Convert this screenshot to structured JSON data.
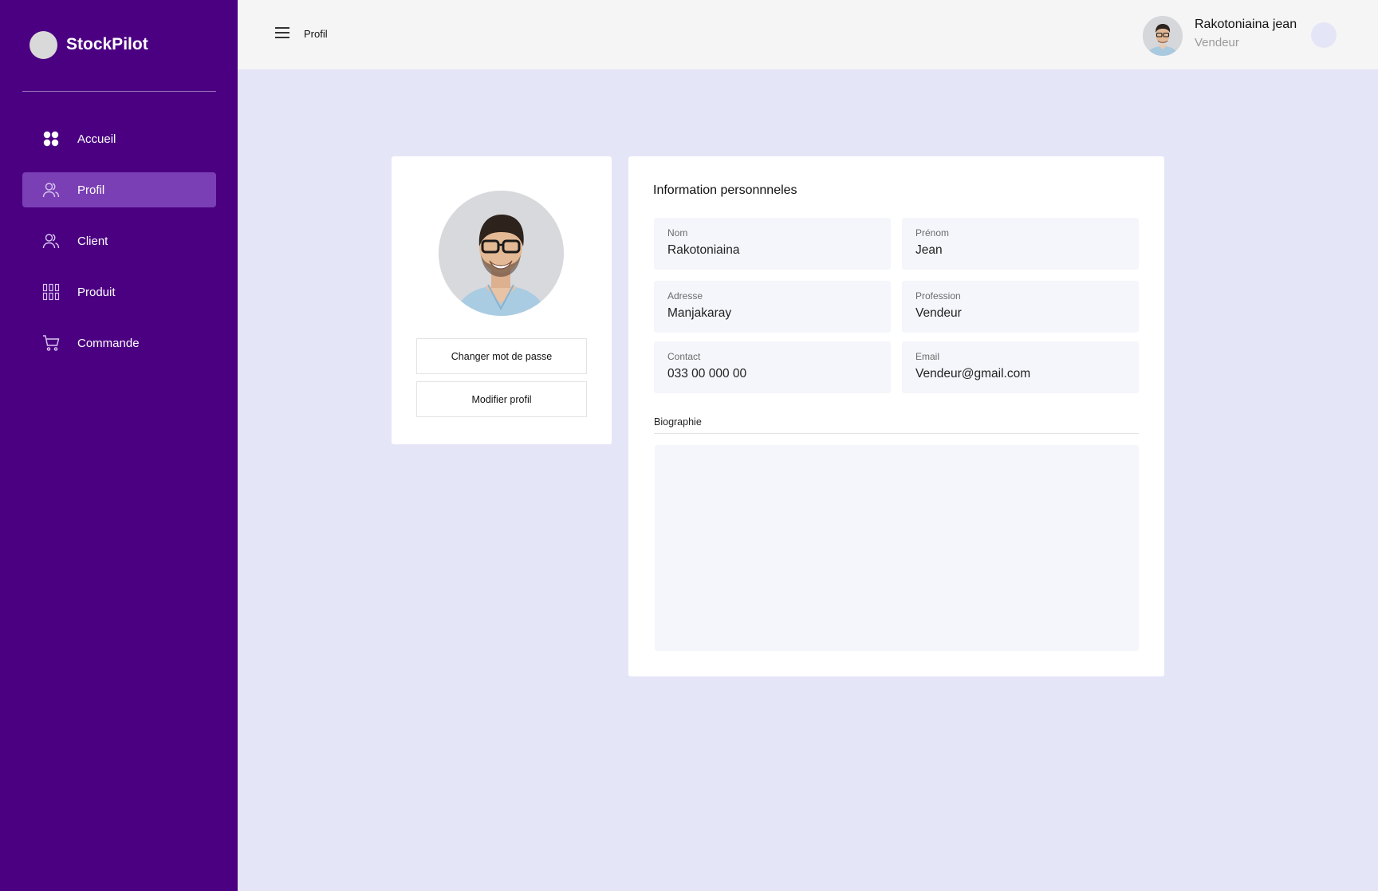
{
  "app": {
    "brand_name": "StockPilot",
    "colors": {
      "sidebar": "#4b0082",
      "sidebar_active": "#7a3fb5",
      "page_bg": "#e5e5f8",
      "header_bg": "#f5f5f5"
    }
  },
  "sidebar": {
    "items": [
      {
        "label": "Accueil",
        "icon": "grid-dots-icon",
        "active": false
      },
      {
        "label": "Profil",
        "icon": "users-icon",
        "active": true
      },
      {
        "label": "Client",
        "icon": "users-icon",
        "active": false
      },
      {
        "label": "Produit",
        "icon": "barcode-icon",
        "active": false
      },
      {
        "label": "Commande",
        "icon": "cart-icon",
        "active": false
      }
    ]
  },
  "header": {
    "breadcrumb": "Profil",
    "user_name": "Rakotoniaina jean",
    "user_role": "Vendeur"
  },
  "profile": {
    "change_password_label": "Changer mot de passe",
    "edit_profile_label": "Modifier profil"
  },
  "info": {
    "title": "Information personnneles",
    "fields": {
      "nom": {
        "label": "Nom",
        "value": "Rakotoniaina"
      },
      "prenom": {
        "label": "Prénom",
        "value": "Jean"
      },
      "adresse": {
        "label": "Adresse",
        "value": "Manjakaray"
      },
      "profession": {
        "label": "Profession",
        "value": "Vendeur"
      },
      "contact": {
        "label": "Contact",
        "value": "033 00 000 00"
      },
      "email": {
        "label": "Email",
        "value": "Vendeur@gmail.com"
      }
    },
    "biography_label": "Biographie",
    "biography_value": ""
  }
}
